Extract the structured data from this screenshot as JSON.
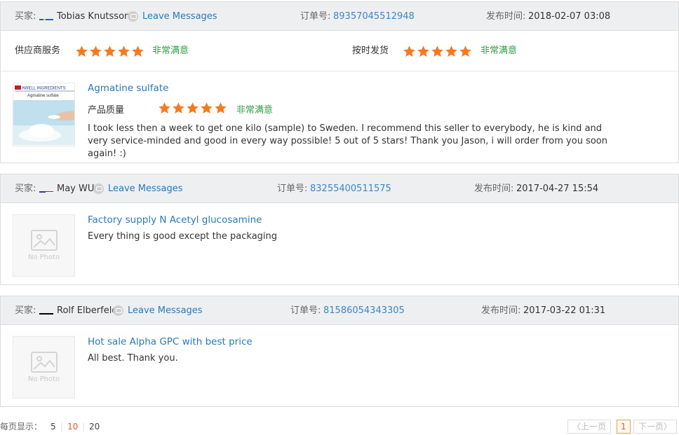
{
  "labels": {
    "buyer": "买家:",
    "order": "订单号:",
    "published": "发布时间:",
    "leave_messages": "Leave Messages",
    "supplier_service": "供应商服务",
    "on_time_delivery": "按时发货",
    "product_quality": "产品质量",
    "very_satisfied": "非常满意",
    "no_photo": "No Photo"
  },
  "colors": {
    "star": "#f47a20",
    "link": "#2a78b8",
    "satisfied": "#2ea043",
    "header_bg": "#eeeff1"
  },
  "reviews": [
    {
      "buyer": "Tobias Knutsson",
      "flag": "sweden",
      "order_no": "89357045512948",
      "date": "2018-02-07 03:08",
      "supplier_service_stars": 5,
      "on_time_stars": 5,
      "product_quality_stars": 5,
      "product": "Agmatine sulfate",
      "thumb_brand": "AWELL INGREDIENTS",
      "thumb_caption": "Agmatine sulfate",
      "text": "I took less then a week to get one kilo (sample) to Sweden. I recommend this seller to everybody, he is kind and very service-minded and good in every way possible! 5 out of 5 stars! Thank you Jason, i will order from you soon again! :)"
    },
    {
      "buyer": "May WU",
      "flag": "usa",
      "order_no": "83255400511575",
      "date": "2017-04-27 15:54",
      "product": "Factory supply N Acetyl glucosamine",
      "text": "Every thing is good except the packaging"
    },
    {
      "buyer": "Rolf Elberfeld",
      "flag": "germany",
      "order_no": "81586054343305",
      "date": "2017-03-22 01:31",
      "product": "Hot sale Alpha GPC with best price",
      "text": "All best. Thank you."
    }
  ],
  "footer": {
    "per_page_label": "每页显示：",
    "per_page_options": [
      "5",
      "10",
      "20"
    ],
    "per_page_selected": "10",
    "prev": "上一页",
    "current_page": "1",
    "next": "下一页"
  }
}
